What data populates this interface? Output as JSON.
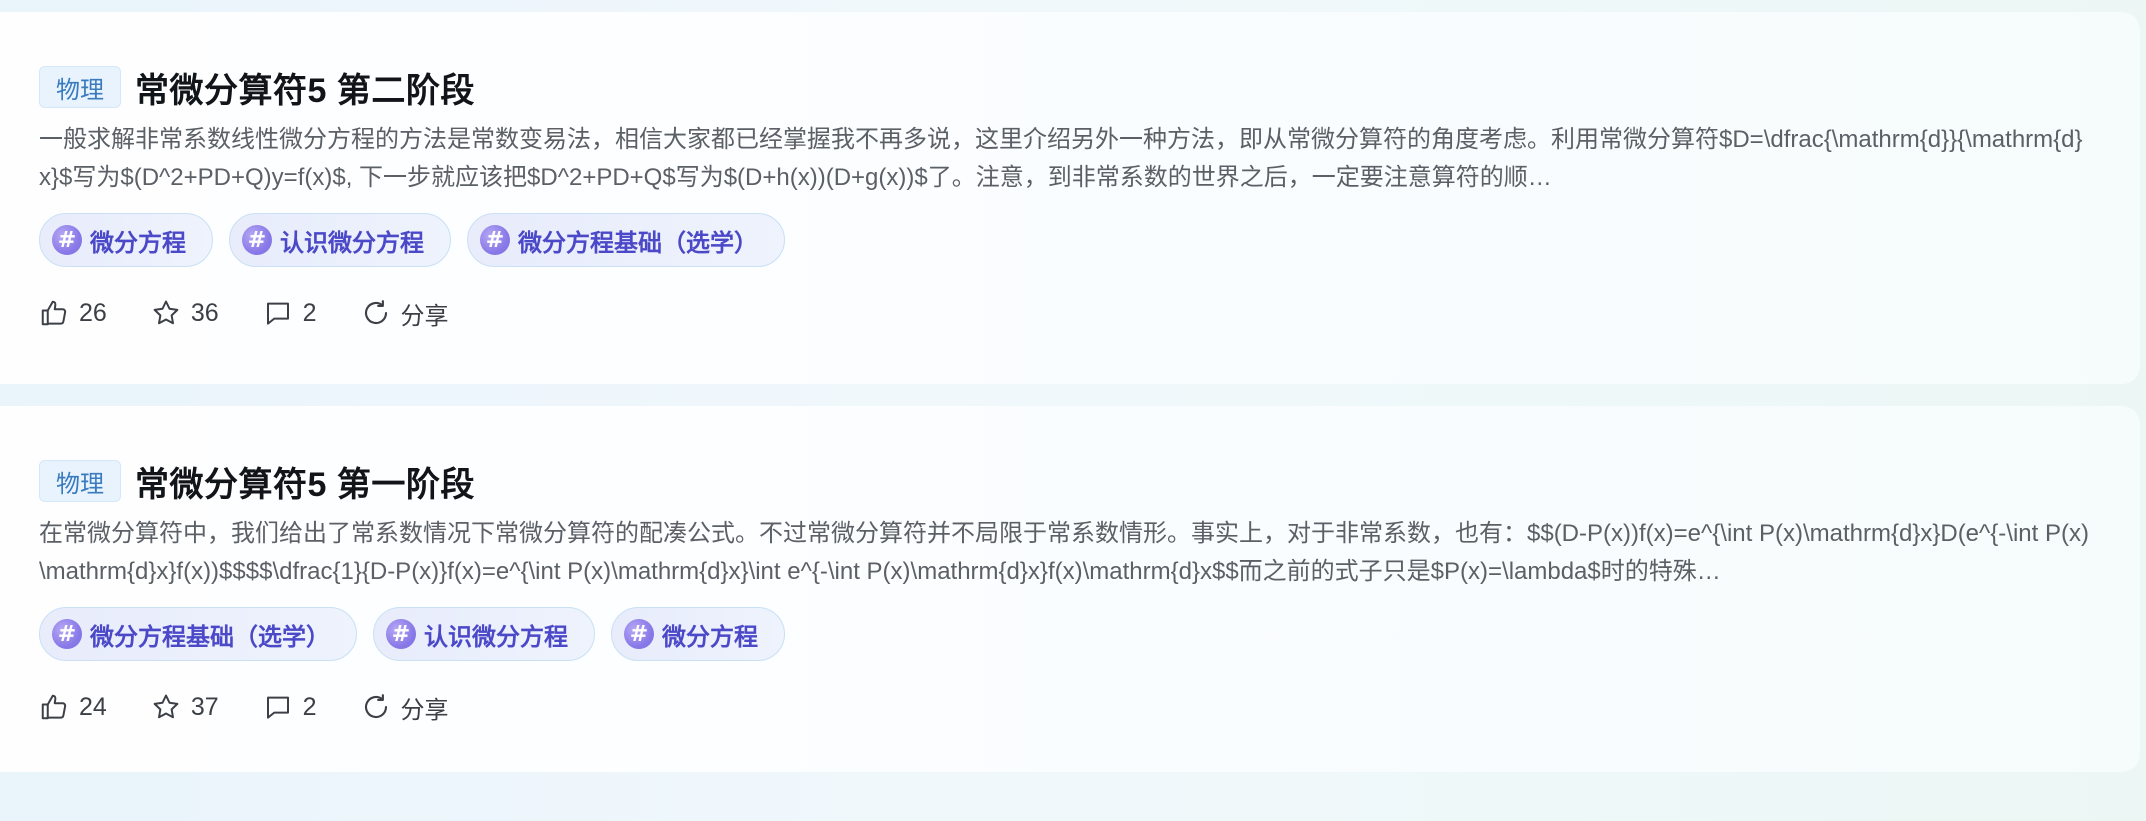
{
  "articles": [
    {
      "subject": "物理",
      "title": "常微分算符5 第二阶段",
      "summary": "一般求解非常系数线性微分方程的方法是常数变易法，相信大家都已经掌握我不再多说，这里介绍另外一种方法，即从常微分算符的角度考虑。利用常微分算符$D=\\dfrac{\\mathrm{d}}{\\mathrm{d}x}$写为$(D^2+PD+Q)y=f(x)$, 下一步就应该把$D^2+PD+Q$写为$(D+h(x))(D+g(x))$了。注意，到非常系数的世界之后，一定要注意算符的顺…",
      "tags": [
        "微分方程",
        "认识微分方程",
        "微分方程基础（选学）"
      ],
      "likes": "26",
      "favorites": "36",
      "comments": "2",
      "share_label": "分享"
    },
    {
      "subject": "物理",
      "title": "常微分算符5 第一阶段",
      "summary": "在常微分算符中，我们给出了常系数情况下常微分算符的配凑公式。不过常微分算符并不局限于常系数情形。事实上，对于非常系数，也有：$$(D-P(x))f(x)=e^{\\int P(x)\\mathrm{d}x}D(e^{-\\int P(x)\\mathrm{d}x}f(x))$$$$\\dfrac{1}{D-P(x)}f(x)=e^{\\int P(x)\\mathrm{d}x}\\int e^{-\\int P(x)\\mathrm{d}x}f(x)\\mathrm{d}x$$而之前的式子只是$P(x)=\\lambda$时的特殊…",
      "tags": [
        "微分方程基础（选学）",
        "认识微分方程",
        "微分方程"
      ],
      "likes": "24",
      "favorites": "37",
      "comments": "2",
      "share_label": "分享"
    }
  ],
  "icons": {
    "tag": "hashtag-icon",
    "like": "thumbs-up-icon",
    "favorite": "star-icon",
    "comment": "comment-icon",
    "share": "share-icon"
  },
  "colors": {
    "badge_text": "#3a7bbf",
    "tag_text": "#4b49c8",
    "tag_icon": "#8a7ae8"
  }
}
